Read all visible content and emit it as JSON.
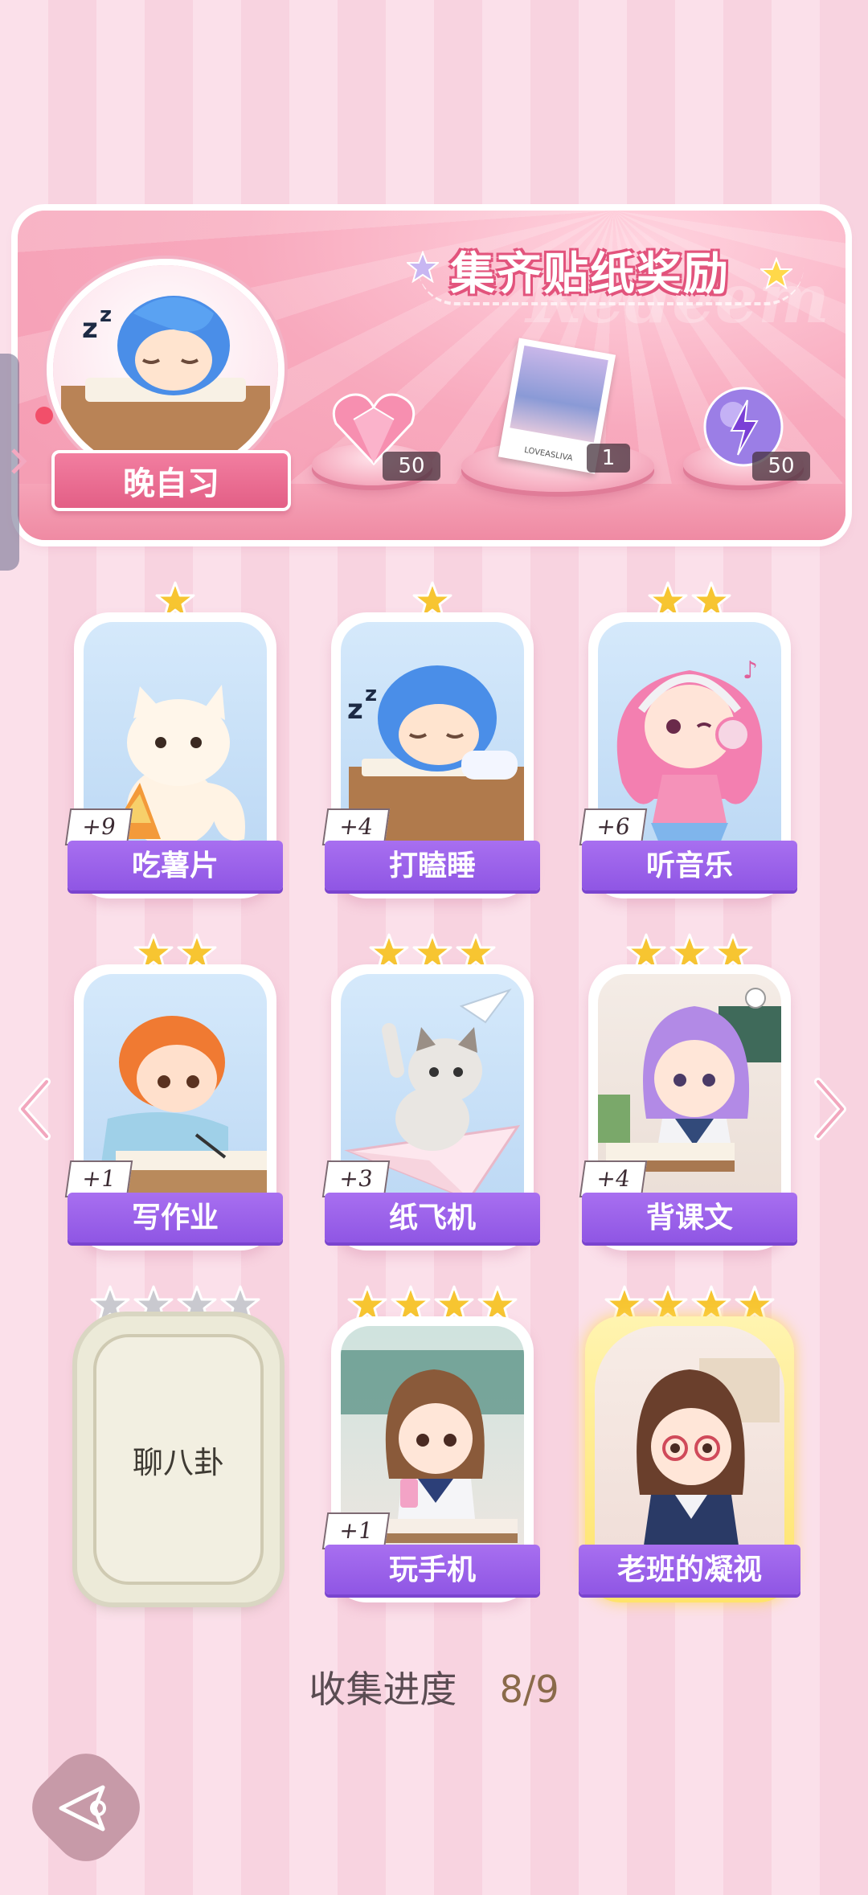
{
  "banner": {
    "title": "集齐贴纸奖励",
    "watermark": "Redeem",
    "main_sticker_label": "晚自习",
    "rewards": [
      {
        "name": "pink-heart-gem",
        "count": "50"
      },
      {
        "name": "photo-card",
        "count": "1",
        "card_caption": "LOVEASLIVA"
      },
      {
        "name": "purple-energy-orb",
        "count": "50"
      }
    ]
  },
  "stickers": [
    {
      "label": "吃薯片",
      "plus": "+9",
      "stars": 1,
      "stars_total": 1,
      "unlocked": true
    },
    {
      "label": "打瞌睡",
      "plus": "+4",
      "stars": 1,
      "stars_total": 1,
      "unlocked": true
    },
    {
      "label": "听音乐",
      "plus": "+6",
      "stars": 2,
      "stars_total": 2,
      "unlocked": true
    },
    {
      "label": "写作业",
      "plus": "+1",
      "stars": 2,
      "stars_total": 2,
      "unlocked": true
    },
    {
      "label": "纸飞机",
      "plus": "+3",
      "stars": 3,
      "stars_total": 3,
      "unlocked": true
    },
    {
      "label": "背课文",
      "plus": "+4",
      "stars": 3,
      "stars_total": 3,
      "unlocked": true
    },
    {
      "label": "聊八卦",
      "plus": "",
      "stars": 0,
      "stars_total": 4,
      "unlocked": false
    },
    {
      "label": "玩手机",
      "plus": "+1",
      "stars": 4,
      "stars_total": 4,
      "unlocked": true
    },
    {
      "label": "老班的凝视",
      "plus": "",
      "stars": 4,
      "stars_total": 4,
      "unlocked": true
    }
  ],
  "progress": {
    "label": "收集进度",
    "value": "8/9"
  },
  "colors": {
    "accent_pink": "#e35f86",
    "label_purple": "#9a60ea",
    "star_gold": "#f7c531",
    "star_gray": "#c9c9cf"
  }
}
